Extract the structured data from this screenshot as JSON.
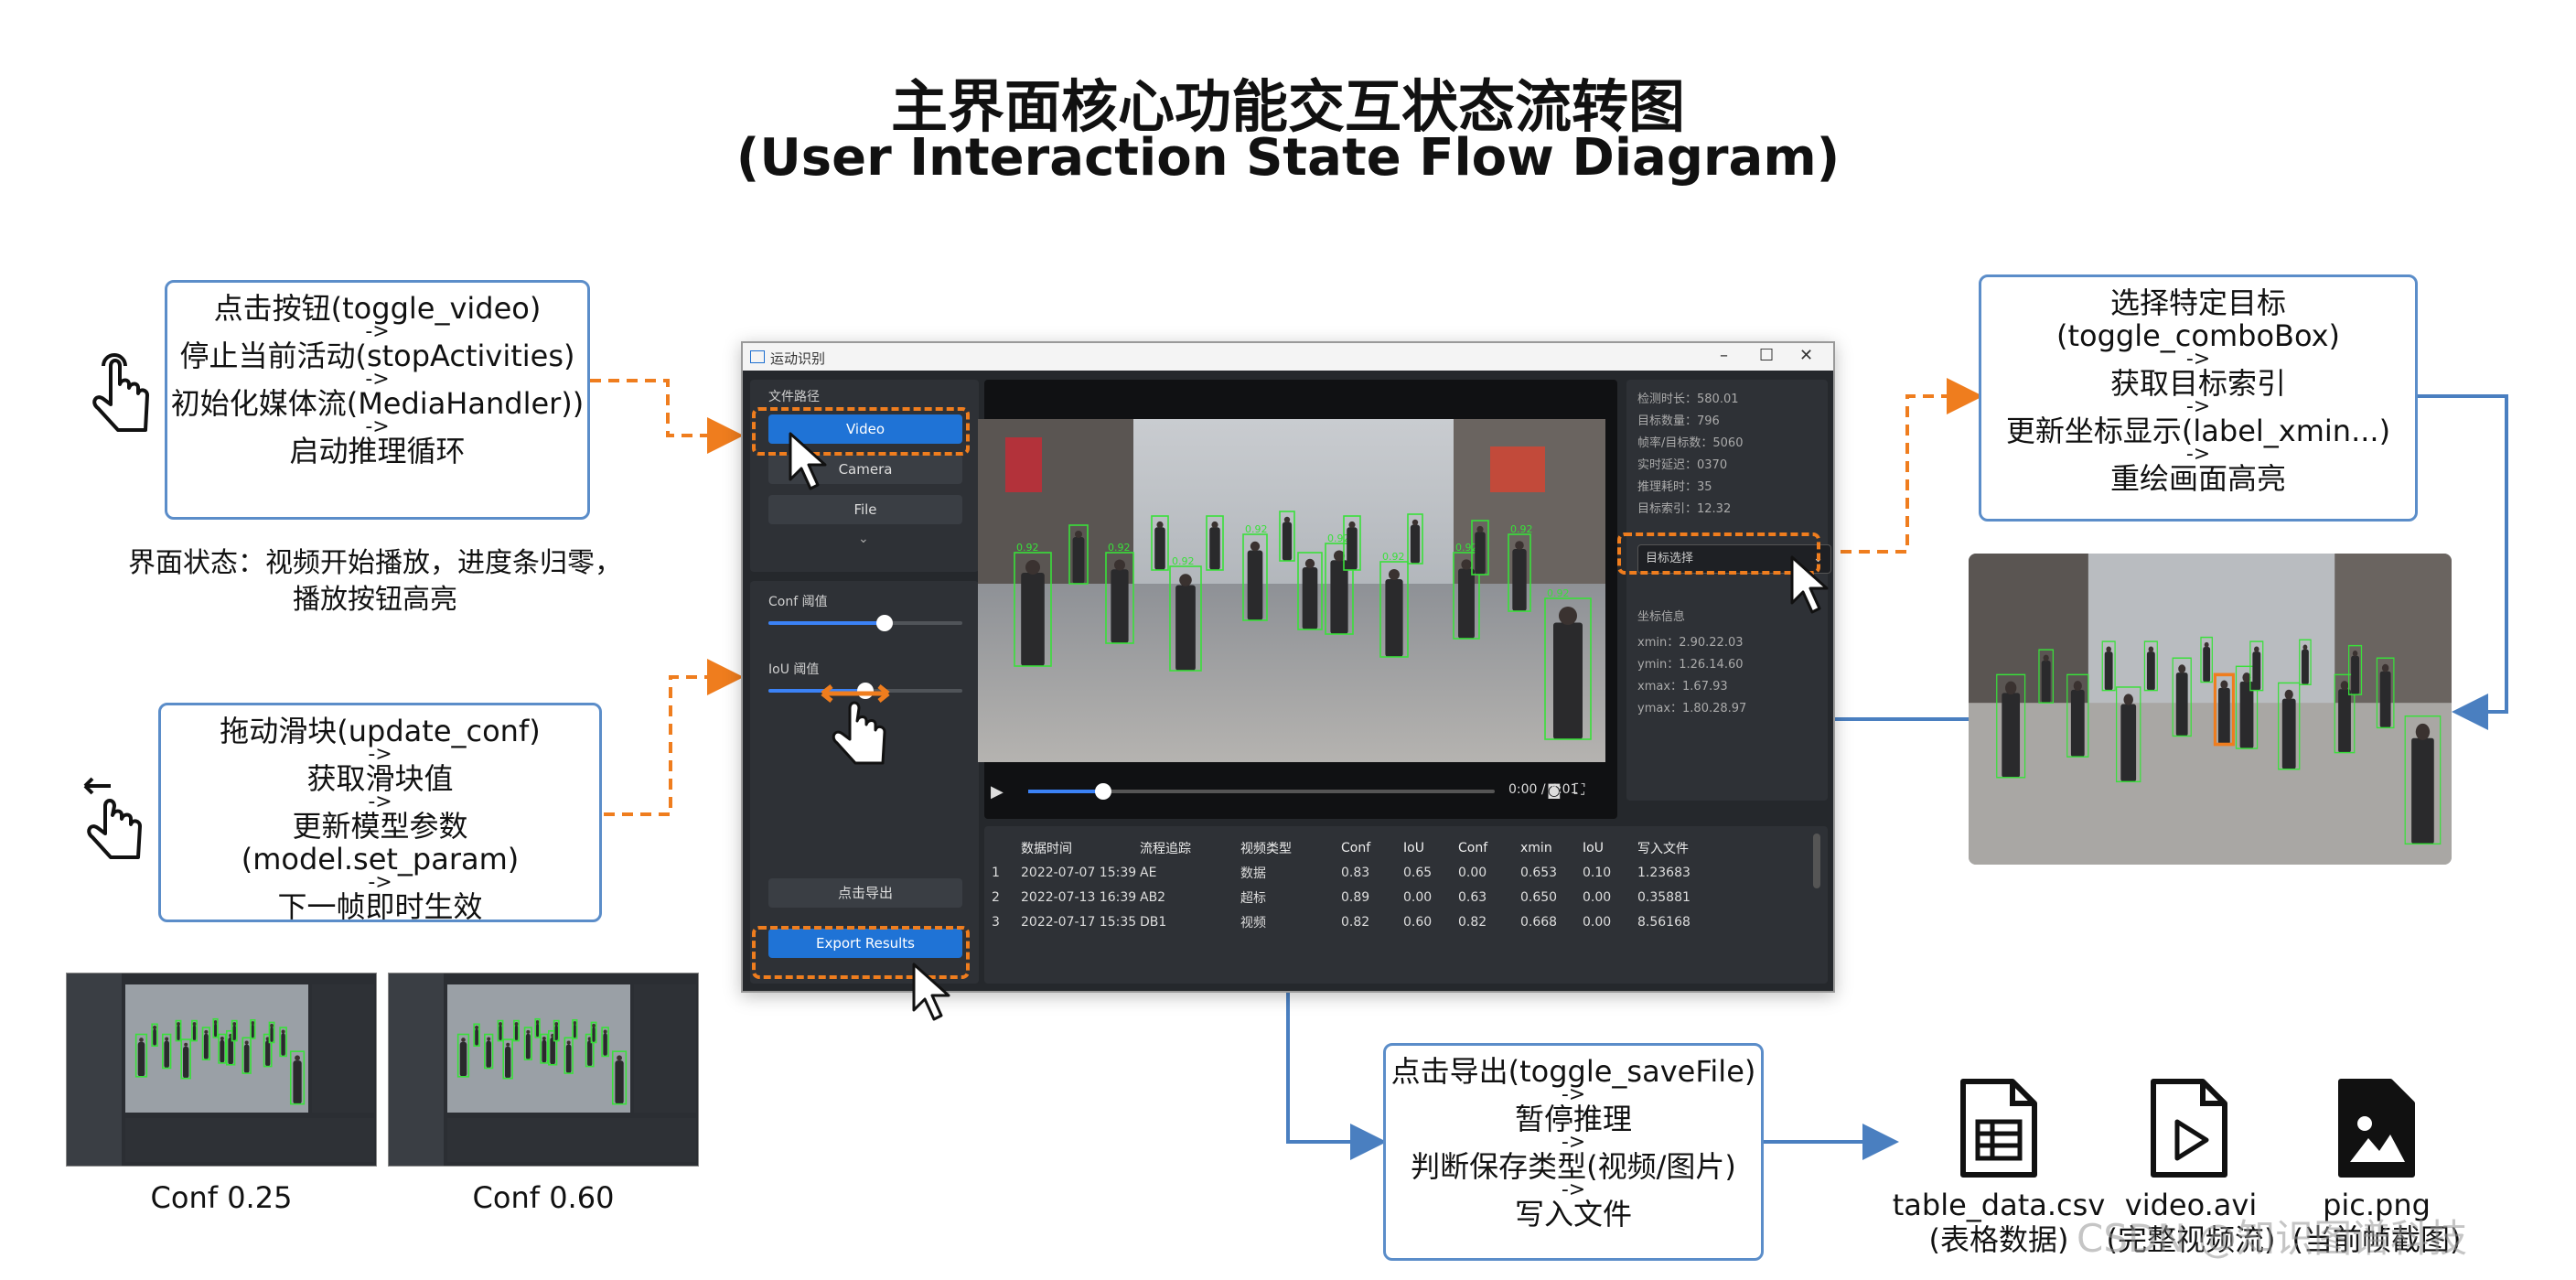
{
  "header": {
    "title_cn": "主界面核心功能交互状态流转图",
    "title_en": "(User Interaction State Flow Diagram)"
  },
  "box_video": {
    "lines": [
      "点击按钮(toggle_video)",
      "停止当前活动(stopActivities)",
      "初始化媒体流(MediaHandler))",
      "启动推理循环"
    ],
    "arrow": "->"
  },
  "note_video": {
    "line1": "界面状态：视频开始播放，进度条归零，",
    "line2": "播放按钮高亮"
  },
  "box_slider": {
    "lines": [
      "拖动滑块(update_conf)",
      "获取滑块值",
      "更新模型参数(model.set_param)",
      "下一帧即时生效"
    ],
    "arrow": "->"
  },
  "box_combo": {
    "lines": [
      "选择特定目标(toggle_comboBox)",
      "获取目标索引",
      "更新坐标显示(label_xmin...)",
      "重绘画面高亮"
    ],
    "arrow": "->"
  },
  "box_save": {
    "lines": [
      "点击导出(toggle_saveFile)",
      "暂停推理",
      "判断保存类型(视频/图片)",
      "写入文件"
    ],
    "arrow": "->"
  },
  "app": {
    "window_title": "运动识别",
    "left_panel": {
      "source_label": "文件路径",
      "video_btn": "Video",
      "camera_btn": "Camera",
      "file_btn": "File",
      "conf_label": "Conf 阈值",
      "iou_label": "IoU 阈值",
      "export_cn_btn": "点击导出",
      "export_btn": "Export Results"
    },
    "player": {
      "time": "0:00 / 4:01",
      "progress": 0.16,
      "conf_slider": 0.6,
      "iou_slider": 0.5
    },
    "info": {
      "lines": [
        "检测时长：580.01",
        "目标数量：796",
        "帧率/目标数：5060",
        "实时延迟：0370",
        "推理耗时：35",
        "目标索引：12.32"
      ],
      "combo": "目标选择",
      "coord_title": "坐标信息",
      "coords": [
        "xmin：2.90.22.03",
        "ymin：1.26.14.60",
        "xmax：1.67.93",
        "ymax：1.80.28.97"
      ]
    },
    "table": {
      "headers": [
        "",
        "数据时间",
        "流程追踪",
        "视频类型",
        "Conf",
        "IoU",
        "Conf",
        "xmin",
        "IoU",
        "写入文件"
      ],
      "rows": [
        [
          "1",
          "2022-07-07 15:39",
          "AE",
          "数据",
          "0.83",
          "0.65",
          "0.00",
          "0.653",
          "0.10",
          "1.23683"
        ],
        [
          "2",
          "2022-07-13 16:39",
          "AB2",
          "超标",
          "0.89",
          "0.00",
          "0.63",
          "0.650",
          "0.00",
          "0.35881"
        ],
        [
          "3",
          "2022-07-17 15:35",
          "DB1",
          "视频",
          "0.82",
          "0.60",
          "0.82",
          "0.668",
          "0.00",
          "8.56168"
        ]
      ]
    },
    "detections": [
      "0.92",
      "0.92",
      "0.92",
      "0.92",
      "0.92",
      "0.92",
      "0.92",
      "0.92",
      "0.92"
    ]
  },
  "thumbnails": [
    {
      "caption": "Conf 0.25",
      "conf": 0.25
    },
    {
      "caption": "Conf 0.60",
      "conf": 0.6
    }
  ],
  "outputs": [
    {
      "name": "table_data.csv",
      "desc": "(表格数据)",
      "icon": "table-file-icon"
    },
    {
      "name": "video.avi",
      "desc": "(完整视频流)",
      "icon": "video-file-icon"
    },
    {
      "name": "pic.png",
      "desc": "(当前帧截图)",
      "icon": "image-file-icon"
    }
  ],
  "watermark": "CSDN @知识图谱科技",
  "colors": {
    "accent_blue": "#5b8dc9",
    "accent_orange": "#ef7d1e",
    "button_blue": "#1f73d6",
    "detect_green": "#39e03a",
    "selected_box": "#ef7d1e"
  }
}
